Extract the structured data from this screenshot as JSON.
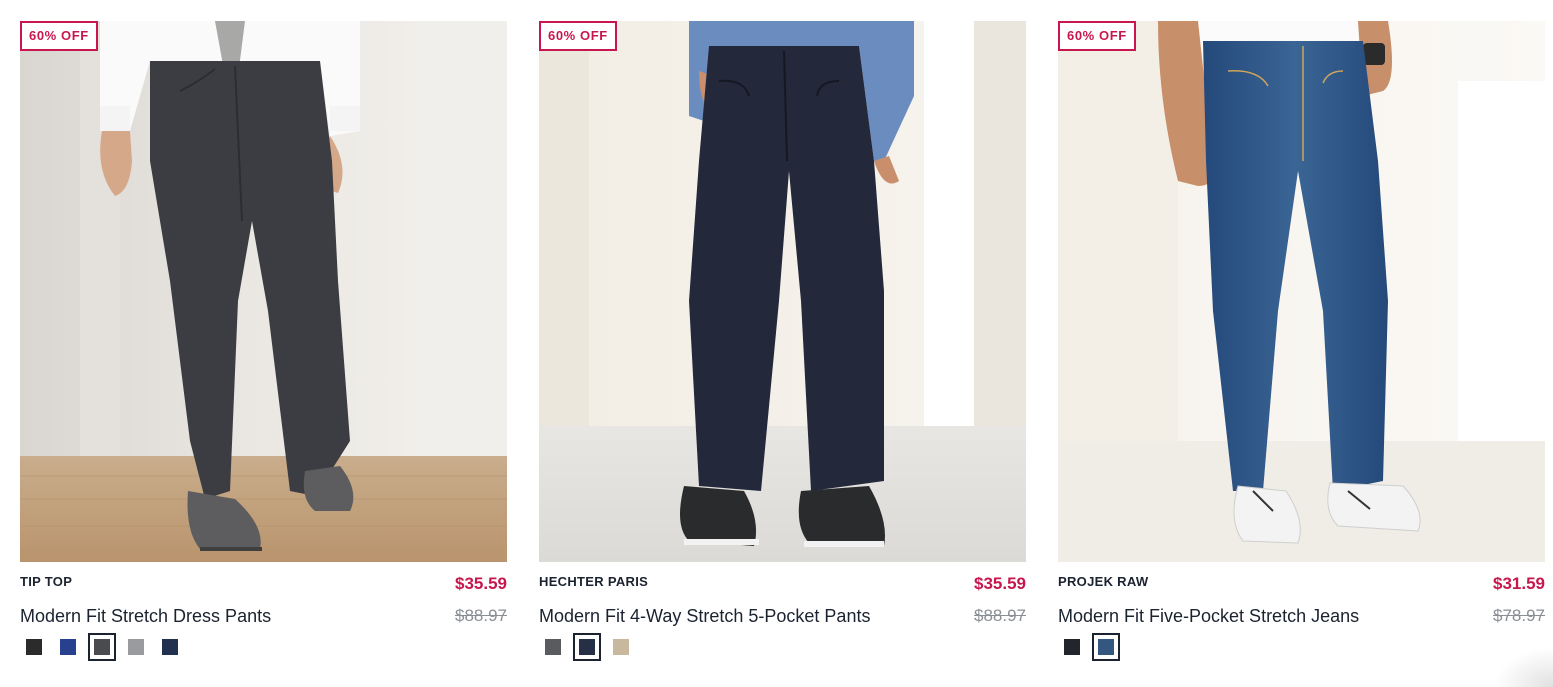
{
  "products": [
    {
      "badge": "60% OFF",
      "brand": "TIP TOP",
      "name": "Modern Fit Stretch Dress Pants",
      "price": "$35.59",
      "original_price": "$88.97",
      "image_icon": "charcoal-dress-pants-photo",
      "swatches": [
        "#2b2b2b",
        "#27418f",
        "#4a4b4f",
        "#9a9b9f",
        "#22304f"
      ],
      "selected_swatch": 2
    },
    {
      "badge": "60% OFF",
      "brand": "HECHTER PARIS",
      "name": "Modern Fit 4-Way Stretch 5-Pocket Pants",
      "price": "$35.59",
      "original_price": "$88.97",
      "image_icon": "navy-5-pocket-pants-photo",
      "swatches": [
        "#5a5b5e",
        "#252f45",
        "#c8b89e"
      ],
      "selected_swatch": 1
    },
    {
      "badge": "60% OFF",
      "brand": "PROJEK RAW",
      "name": "Modern Fit Five-Pocket Stretch Jeans",
      "price": "$31.59",
      "original_price": "$78.97",
      "image_icon": "blue-stretch-jeans-photo",
      "swatches": [
        "#22262c",
        "#33577f"
      ],
      "selected_swatch": 1
    }
  ],
  "colors": {
    "sale_accent": "#c8174e",
    "text_dark": "#1b2330",
    "strike_grey": "#8a8f96"
  }
}
